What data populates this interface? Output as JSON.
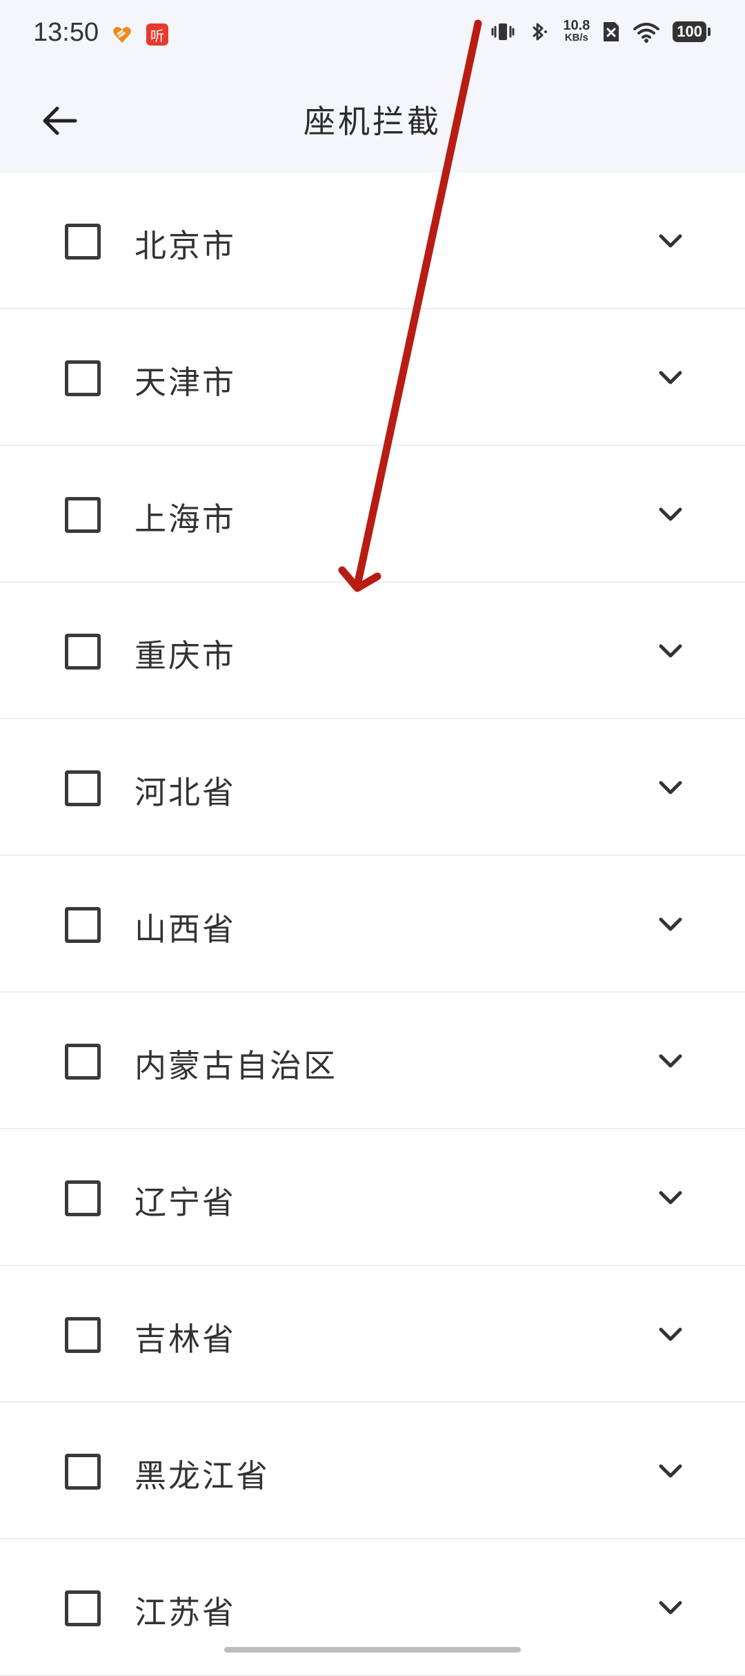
{
  "status_bar": {
    "time": "13:50",
    "app_badge": "听",
    "network_speed": {
      "value": "10.8",
      "unit": "KB/s"
    },
    "battery": "100",
    "icons": [
      "vibrate-icon",
      "bluetooth-icon",
      "sim-off-icon",
      "wifi-icon"
    ]
  },
  "header": {
    "title": "座机拦截",
    "back_icon": "arrow-left-icon"
  },
  "regions": [
    {
      "label": "北京市",
      "checked": false
    },
    {
      "label": "天津市",
      "checked": false
    },
    {
      "label": "上海市",
      "checked": false
    },
    {
      "label": "重庆市",
      "checked": false
    },
    {
      "label": "河北省",
      "checked": false
    },
    {
      "label": "山西省",
      "checked": false
    },
    {
      "label": "内蒙古自治区",
      "checked": false
    },
    {
      "label": "辽宁省",
      "checked": false
    },
    {
      "label": "吉林省",
      "checked": false
    },
    {
      "label": "黑龙江省",
      "checked": false
    },
    {
      "label": "江苏省",
      "checked": false
    }
  ],
  "colors": {
    "header_bg": "#f4f6fb",
    "text": "#333333",
    "divider": "#eeeeee",
    "annotation_arrow": "#b81c12"
  }
}
